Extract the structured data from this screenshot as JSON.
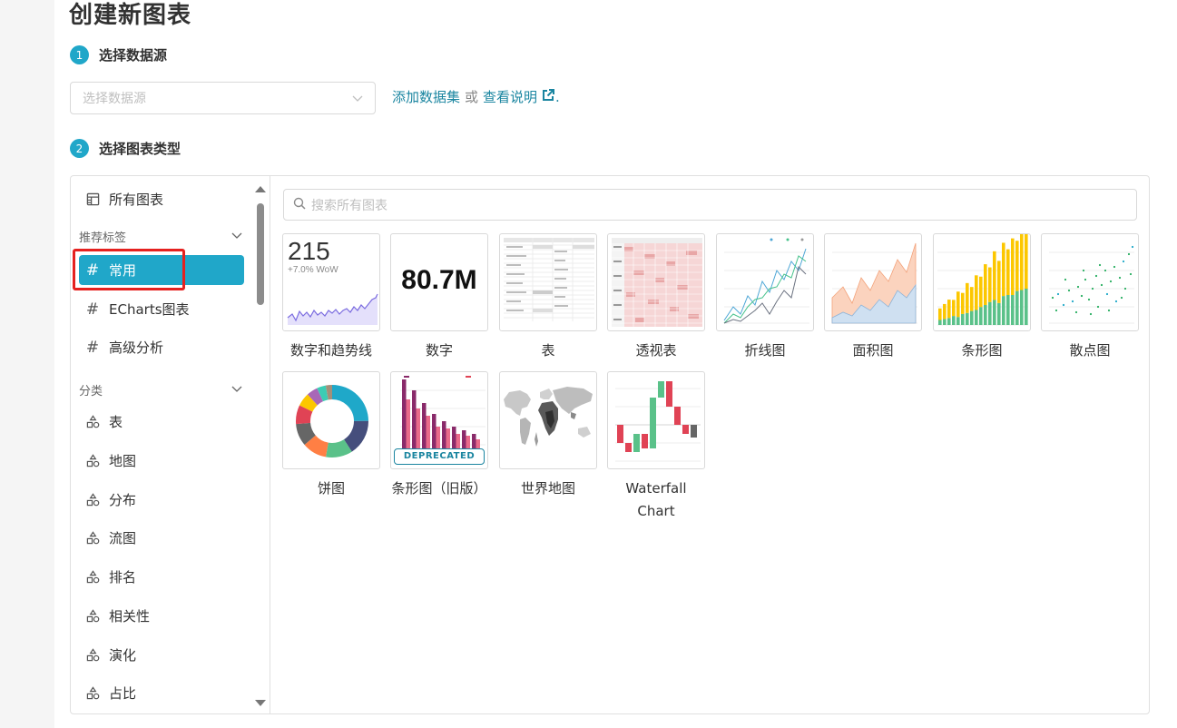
{
  "page": {
    "title": "创建新图表"
  },
  "steps": [
    {
      "number": "1",
      "label": "选择数据源"
    },
    {
      "number": "2",
      "label": "选择图表类型"
    }
  ],
  "datasource": {
    "placeholder": "选择数据源",
    "add_dataset_link": "添加数据集",
    "or_text": "或",
    "view_docs_link": "查看说明",
    "trailing_dot": "."
  },
  "sidebar": {
    "all_charts": "所有图表",
    "recommended_header": "推荐标签",
    "recommended": [
      "常用",
      "ECharts图表",
      "高级分析"
    ],
    "category_header": "分类",
    "categories": [
      "表",
      "地图",
      "分布",
      "流图",
      "排名",
      "相关性",
      "演化",
      "占比"
    ],
    "selected": "常用"
  },
  "search": {
    "placeholder": "搜索所有图表"
  },
  "charts": [
    {
      "name": "数字和趋势线",
      "icon": "big-number-trendline",
      "number": "215",
      "sub": "+7.0% WoW"
    },
    {
      "name": "数字",
      "icon": "big-number",
      "number": "80.7M"
    },
    {
      "name": "表",
      "icon": "table"
    },
    {
      "name": "透视表",
      "icon": "pivot-table"
    },
    {
      "name": "折线图",
      "icon": "line-chart"
    },
    {
      "name": "面积图",
      "icon": "area-chart"
    },
    {
      "name": "条形图",
      "icon": "bar-chart"
    },
    {
      "name": "散点图",
      "icon": "scatter-plot"
    },
    {
      "name": "饼图",
      "icon": "pie-chart"
    },
    {
      "name": "条形图（旧版）",
      "icon": "bar-chart-legacy",
      "badge": "DEPRECATED"
    },
    {
      "name": "世界地图",
      "icon": "world-map"
    },
    {
      "name": "Waterfall Chart",
      "icon": "waterfall-chart"
    }
  ],
  "colors": {
    "accent": "#20a7c9",
    "link": "#1a85a0",
    "highlight_box": "#e5211f"
  }
}
